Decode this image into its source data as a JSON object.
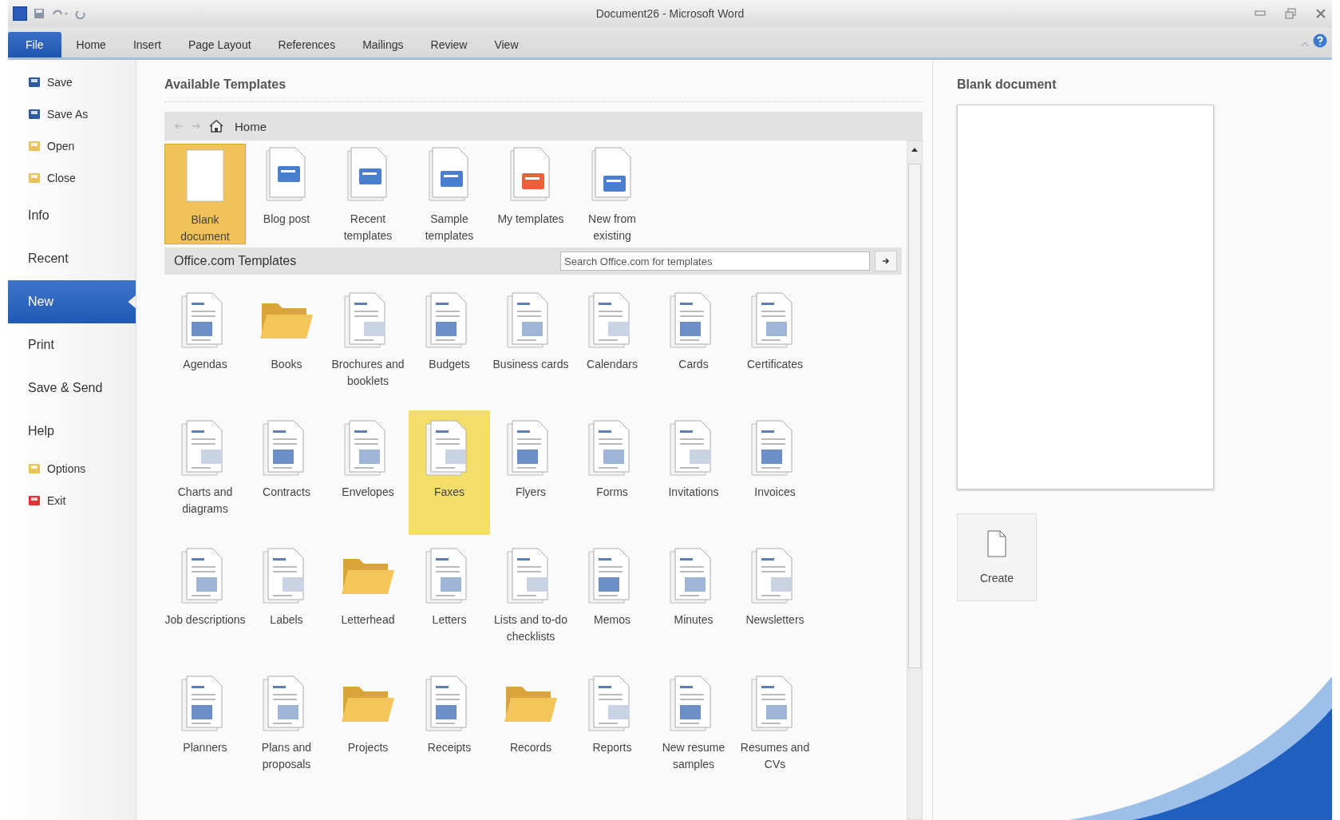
{
  "window": {
    "title": "Document26 - Microsoft Word"
  },
  "ribbon_tabs": [
    {
      "label": "File",
      "selected": true
    },
    {
      "label": "Home",
      "selected": false
    },
    {
      "label": "Insert",
      "selected": false
    },
    {
      "label": "Page Layout",
      "selected": false
    },
    {
      "label": "References",
      "selected": false
    },
    {
      "label": "Mailings",
      "selected": false
    },
    {
      "label": "Review",
      "selected": false
    },
    {
      "label": "View",
      "selected": false
    }
  ],
  "sidebar": {
    "items": [
      {
        "label": "Save",
        "kind": "command",
        "selected": false
      },
      {
        "label": "Save As",
        "kind": "command",
        "selected": false
      },
      {
        "label": "Open",
        "kind": "command",
        "selected": false
      },
      {
        "label": "Close",
        "kind": "command",
        "selected": false
      },
      {
        "label": "Info",
        "kind": "section",
        "selected": false
      },
      {
        "label": "Recent",
        "kind": "section",
        "selected": false
      },
      {
        "label": "New",
        "kind": "section",
        "selected": true
      },
      {
        "label": "Print",
        "kind": "section",
        "selected": false
      },
      {
        "label": "Save & Send",
        "kind": "section",
        "selected": false
      },
      {
        "label": "Help",
        "kind": "section",
        "selected": false
      },
      {
        "label": "Options",
        "kind": "command",
        "selected": false
      },
      {
        "label": "Exit",
        "kind": "command",
        "selected": false
      }
    ]
  },
  "templates": {
    "title": "Available Templates",
    "breadcrumb": "Home",
    "featured": [
      {
        "label": "Blank document",
        "kind": "blank",
        "selected": true
      },
      {
        "label": "Blog post",
        "kind": "doc",
        "selected": false
      },
      {
        "label": "Recent templates",
        "kind": "doc",
        "selected": false
      },
      {
        "label": "Sample templates",
        "kind": "doc",
        "selected": false
      },
      {
        "label": "My templates",
        "kind": "doc",
        "selected": false
      },
      {
        "label": "New from existing",
        "kind": "doc",
        "selected": false
      }
    ],
    "office_title": "Office.com Templates",
    "search": {
      "placeholder": "Search Office.com for templates"
    },
    "office": [
      {
        "label": "Agendas",
        "kind": "doc",
        "selected": false
      },
      {
        "label": "Books",
        "kind": "folder",
        "selected": false
      },
      {
        "label": "Brochures and booklets",
        "kind": "doc",
        "selected": false
      },
      {
        "label": "Budgets",
        "kind": "doc",
        "selected": false
      },
      {
        "label": "Business cards",
        "kind": "doc",
        "selected": false
      },
      {
        "label": "Calendars",
        "kind": "doc",
        "selected": false
      },
      {
        "label": "Cards",
        "kind": "doc",
        "selected": false
      },
      {
        "label": "Certificates",
        "kind": "doc",
        "selected": false
      },
      {
        "label": "Charts and diagrams",
        "kind": "doc",
        "selected": false
      },
      {
        "label": "Contracts",
        "kind": "doc",
        "selected": false
      },
      {
        "label": "Envelopes",
        "kind": "doc",
        "selected": false
      },
      {
        "label": "Faxes",
        "kind": "doc",
        "selected": true
      },
      {
        "label": "Flyers",
        "kind": "doc",
        "selected": false
      },
      {
        "label": "Forms",
        "kind": "doc",
        "selected": false
      },
      {
        "label": "Invitations",
        "kind": "doc",
        "selected": false
      },
      {
        "label": "Invoices",
        "kind": "doc",
        "selected": false
      },
      {
        "label": "Job descriptions",
        "kind": "doc",
        "selected": false
      },
      {
        "label": "Labels",
        "kind": "doc",
        "selected": false
      },
      {
        "label": "Letterhead",
        "kind": "folder",
        "selected": false
      },
      {
        "label": "Letters",
        "kind": "doc",
        "selected": false
      },
      {
        "label": "Lists and to-do checklists",
        "kind": "doc",
        "selected": false
      },
      {
        "label": "Memos",
        "kind": "doc",
        "selected": false
      },
      {
        "label": "Minutes",
        "kind": "doc",
        "selected": false
      },
      {
        "label": "Newsletters",
        "kind": "doc",
        "selected": false
      },
      {
        "label": "Planners",
        "kind": "doc",
        "selected": false
      },
      {
        "label": "Plans and proposals",
        "kind": "doc",
        "selected": false
      },
      {
        "label": "Projects",
        "kind": "folder",
        "selected": false
      },
      {
        "label": "Receipts",
        "kind": "doc",
        "selected": false
      },
      {
        "label": "Records",
        "kind": "folder",
        "selected": false
      },
      {
        "label": "Reports",
        "kind": "doc",
        "selected": false
      },
      {
        "label": "New resume samples",
        "kind": "doc",
        "selected": false
      },
      {
        "label": "Resumes and CVs",
        "kind": "doc",
        "selected": false
      }
    ]
  },
  "preview": {
    "title": "Blank document",
    "button": "Create"
  }
}
